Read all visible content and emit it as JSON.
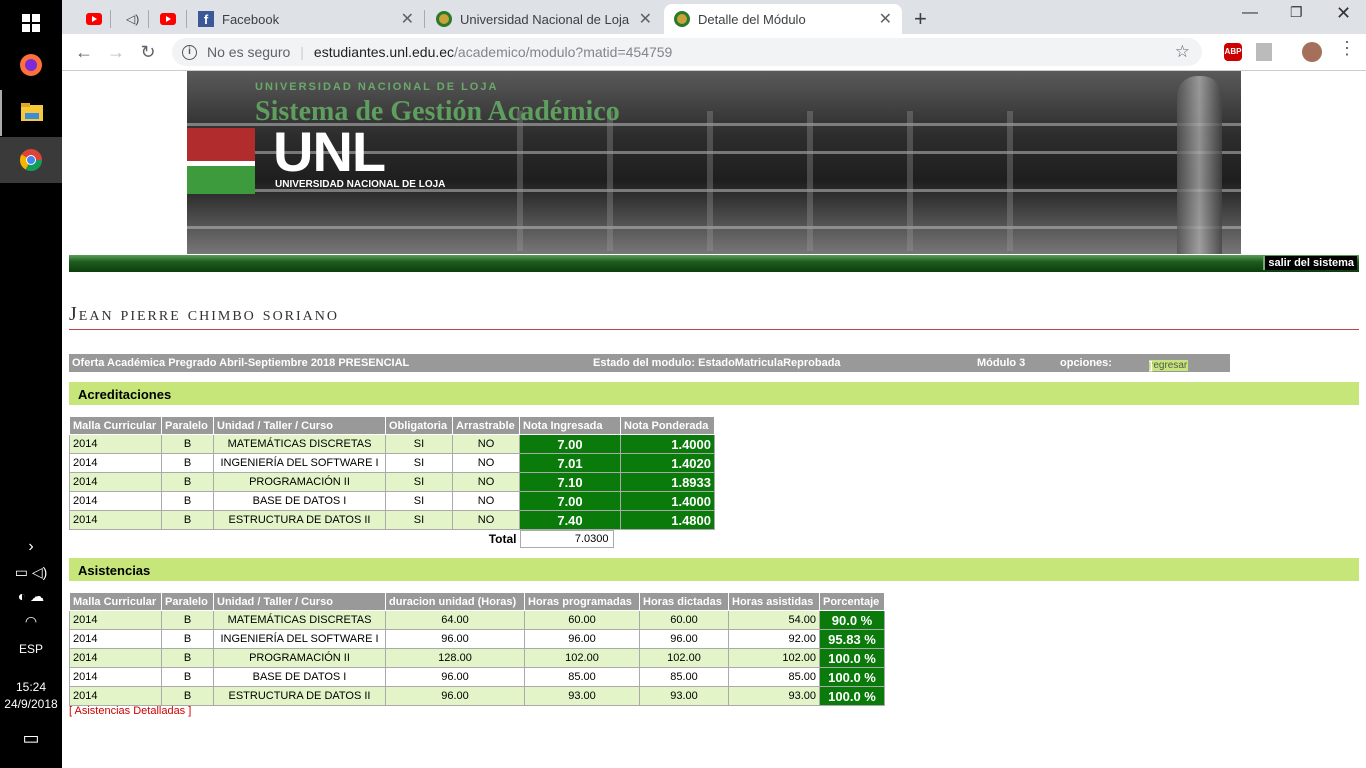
{
  "taskbar": {
    "lang": "ESP",
    "time": "15:24",
    "date": "24/9/2018"
  },
  "browser": {
    "tabs": [
      {
        "title": "Facebook"
      },
      {
        "title": "Universidad Nacional de Loja"
      },
      {
        "title": "Detalle del Módulo"
      }
    ],
    "security_label": "No es seguro",
    "url_domain": "estudiantes.unl.edu.ec",
    "url_path": "/academico/modulo?matid=454759",
    "abp": "ABP"
  },
  "banner": {
    "university_small": "UNIVERSIDAD NACIONAL DE LOJA",
    "system_title": "Sistema de Gestión Académico",
    "logo_text": "UNL",
    "logo_sub": "UNIVERSIDAD NACIONAL DE LOJA"
  },
  "logout_label": "salir del sistema",
  "student_name": "Jean pierre chimbo soriano",
  "info": {
    "offer": "Oferta Académica Pregrado Abril-Septiembre 2018 PRESENCIAL",
    "state": "Estado del modulo: EstadoMatriculaReprobada",
    "module": "Módulo 3",
    "options_label": "opciones:",
    "back_bracket_open": "[",
    "back_label": "regresar",
    "back_bracket_close": "]"
  },
  "accreditations": {
    "title": "Acreditaciones",
    "headers": [
      "Malla Curricular",
      "Paralelo",
      "Unidad / Taller / Curso",
      "Obligatoria",
      "Arrastrable",
      "Nota Ingresada",
      "Nota Ponderada"
    ],
    "rows": [
      [
        "2014",
        "B",
        "MATEMÁTICAS DISCRETAS",
        "SI",
        "NO",
        "7.00",
        "1.4000"
      ],
      [
        "2014",
        "B",
        "INGENIERÍA DEL SOFTWARE I",
        "SI",
        "NO",
        "7.01",
        "1.4020"
      ],
      [
        "2014",
        "B",
        "PROGRAMACIÓN II",
        "SI",
        "NO",
        "7.10",
        "1.8933"
      ],
      [
        "2014",
        "B",
        "BASE DE DATOS I",
        "SI",
        "NO",
        "7.00",
        "1.4000"
      ],
      [
        "2014",
        "B",
        "ESTRUCTURA DE DATOS II",
        "SI",
        "NO",
        "7.40",
        "1.4800"
      ]
    ],
    "total_label": "Total",
    "total_value": "7.0300"
  },
  "attendance": {
    "title": "Asistencias",
    "headers": [
      "Malla Curricular",
      "Paralelo",
      "Unidad / Taller / Curso",
      "duracion unidad (Horas)",
      "Horas programadas",
      "Horas dictadas",
      "Horas asistidas",
      "Porcentaje"
    ],
    "rows": [
      [
        "2014",
        "B",
        "MATEMÁTICAS DISCRETAS",
        "64.00",
        "60.00",
        "60.00",
        "54.00",
        "90.0 %"
      ],
      [
        "2014",
        "B",
        "INGENIERÍA DEL SOFTWARE I",
        "96.00",
        "96.00",
        "96.00",
        "92.00",
        "95.83 %"
      ],
      [
        "2014",
        "B",
        "PROGRAMACIÓN II",
        "128.00",
        "102.00",
        "102.00",
        "102.00",
        "100.0 %"
      ],
      [
        "2014",
        "B",
        "BASE DE DATOS I",
        "96.00",
        "85.00",
        "85.00",
        "85.00",
        "100.0 %"
      ],
      [
        "2014",
        "B",
        "ESTRUCTURA DE DATOS II",
        "96.00",
        "93.00",
        "93.00",
        "93.00",
        "100.0 %"
      ]
    ],
    "detail_bracket_open": "[",
    "detail_link": "Asistencias Detalladas",
    "detail_bracket_close": "]"
  },
  "colors": {
    "note_green": "#0a7a0a",
    "section_green": "#c6e67a",
    "row_green": "#e3f4c8"
  }
}
